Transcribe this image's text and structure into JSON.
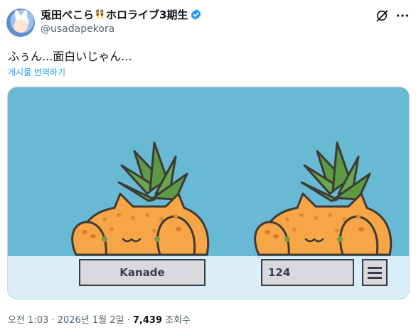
{
  "author": {
    "display_name": "兎田ぺこら",
    "badge": "👯",
    "name_suffix": "ホロライブ3期生",
    "handle": "@usadapekora",
    "verified": true
  },
  "tweet": {
    "text": "ふぅん...面白いじゃん...",
    "translate_label": "게시물 번역하기"
  },
  "media": {
    "name_field_value": "Kanade",
    "number_field_value": "124"
  },
  "meta": {
    "time": "오전 1:03",
    "separator": "·",
    "date": "2026년 1월 2일",
    "views_count": "7,439",
    "views_label": "조회수"
  },
  "icons": {
    "grok": "grok-icon",
    "more": "more-icon",
    "verified": "verified-badge-icon",
    "menu": "hamburger-menu-icon"
  },
  "colors": {
    "accent": "#1d9bf0",
    "image_sky": "#67b9d4",
    "image_floor": "#d9eef6",
    "pineapple_body": "#f6a646",
    "leaves": "#5c9a44"
  }
}
